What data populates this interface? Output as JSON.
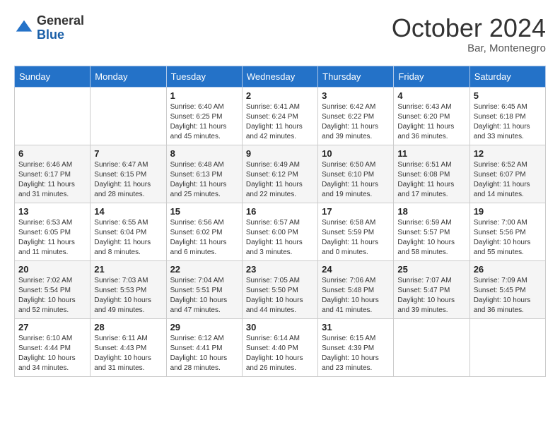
{
  "header": {
    "logo_general": "General",
    "logo_blue": "Blue",
    "month_title": "October 2024",
    "subtitle": "Bar, Montenegro"
  },
  "weekdays": [
    "Sunday",
    "Monday",
    "Tuesday",
    "Wednesday",
    "Thursday",
    "Friday",
    "Saturday"
  ],
  "weeks": [
    [
      {
        "day": "",
        "info": ""
      },
      {
        "day": "",
        "info": ""
      },
      {
        "day": "1",
        "info": "Sunrise: 6:40 AM\nSunset: 6:25 PM\nDaylight: 11 hours and 45 minutes."
      },
      {
        "day": "2",
        "info": "Sunrise: 6:41 AM\nSunset: 6:24 PM\nDaylight: 11 hours and 42 minutes."
      },
      {
        "day": "3",
        "info": "Sunrise: 6:42 AM\nSunset: 6:22 PM\nDaylight: 11 hours and 39 minutes."
      },
      {
        "day": "4",
        "info": "Sunrise: 6:43 AM\nSunset: 6:20 PM\nDaylight: 11 hours and 36 minutes."
      },
      {
        "day": "5",
        "info": "Sunrise: 6:45 AM\nSunset: 6:18 PM\nDaylight: 11 hours and 33 minutes."
      }
    ],
    [
      {
        "day": "6",
        "info": "Sunrise: 6:46 AM\nSunset: 6:17 PM\nDaylight: 11 hours and 31 minutes."
      },
      {
        "day": "7",
        "info": "Sunrise: 6:47 AM\nSunset: 6:15 PM\nDaylight: 11 hours and 28 minutes."
      },
      {
        "day": "8",
        "info": "Sunrise: 6:48 AM\nSunset: 6:13 PM\nDaylight: 11 hours and 25 minutes."
      },
      {
        "day": "9",
        "info": "Sunrise: 6:49 AM\nSunset: 6:12 PM\nDaylight: 11 hours and 22 minutes."
      },
      {
        "day": "10",
        "info": "Sunrise: 6:50 AM\nSunset: 6:10 PM\nDaylight: 11 hours and 19 minutes."
      },
      {
        "day": "11",
        "info": "Sunrise: 6:51 AM\nSunset: 6:08 PM\nDaylight: 11 hours and 17 minutes."
      },
      {
        "day": "12",
        "info": "Sunrise: 6:52 AM\nSunset: 6:07 PM\nDaylight: 11 hours and 14 minutes."
      }
    ],
    [
      {
        "day": "13",
        "info": "Sunrise: 6:53 AM\nSunset: 6:05 PM\nDaylight: 11 hours and 11 minutes."
      },
      {
        "day": "14",
        "info": "Sunrise: 6:55 AM\nSunset: 6:04 PM\nDaylight: 11 hours and 8 minutes."
      },
      {
        "day": "15",
        "info": "Sunrise: 6:56 AM\nSunset: 6:02 PM\nDaylight: 11 hours and 6 minutes."
      },
      {
        "day": "16",
        "info": "Sunrise: 6:57 AM\nSunset: 6:00 PM\nDaylight: 11 hours and 3 minutes."
      },
      {
        "day": "17",
        "info": "Sunrise: 6:58 AM\nSunset: 5:59 PM\nDaylight: 11 hours and 0 minutes."
      },
      {
        "day": "18",
        "info": "Sunrise: 6:59 AM\nSunset: 5:57 PM\nDaylight: 10 hours and 58 minutes."
      },
      {
        "day": "19",
        "info": "Sunrise: 7:00 AM\nSunset: 5:56 PM\nDaylight: 10 hours and 55 minutes."
      }
    ],
    [
      {
        "day": "20",
        "info": "Sunrise: 7:02 AM\nSunset: 5:54 PM\nDaylight: 10 hours and 52 minutes."
      },
      {
        "day": "21",
        "info": "Sunrise: 7:03 AM\nSunset: 5:53 PM\nDaylight: 10 hours and 49 minutes."
      },
      {
        "day": "22",
        "info": "Sunrise: 7:04 AM\nSunset: 5:51 PM\nDaylight: 10 hours and 47 minutes."
      },
      {
        "day": "23",
        "info": "Sunrise: 7:05 AM\nSunset: 5:50 PM\nDaylight: 10 hours and 44 minutes."
      },
      {
        "day": "24",
        "info": "Sunrise: 7:06 AM\nSunset: 5:48 PM\nDaylight: 10 hours and 41 minutes."
      },
      {
        "day": "25",
        "info": "Sunrise: 7:07 AM\nSunset: 5:47 PM\nDaylight: 10 hours and 39 minutes."
      },
      {
        "day": "26",
        "info": "Sunrise: 7:09 AM\nSunset: 5:45 PM\nDaylight: 10 hours and 36 minutes."
      }
    ],
    [
      {
        "day": "27",
        "info": "Sunrise: 6:10 AM\nSunset: 4:44 PM\nDaylight: 10 hours and 34 minutes."
      },
      {
        "day": "28",
        "info": "Sunrise: 6:11 AM\nSunset: 4:43 PM\nDaylight: 10 hours and 31 minutes."
      },
      {
        "day": "29",
        "info": "Sunrise: 6:12 AM\nSunset: 4:41 PM\nDaylight: 10 hours and 28 minutes."
      },
      {
        "day": "30",
        "info": "Sunrise: 6:14 AM\nSunset: 4:40 PM\nDaylight: 10 hours and 26 minutes."
      },
      {
        "day": "31",
        "info": "Sunrise: 6:15 AM\nSunset: 4:39 PM\nDaylight: 10 hours and 23 minutes."
      },
      {
        "day": "",
        "info": ""
      },
      {
        "day": "",
        "info": ""
      }
    ]
  ]
}
